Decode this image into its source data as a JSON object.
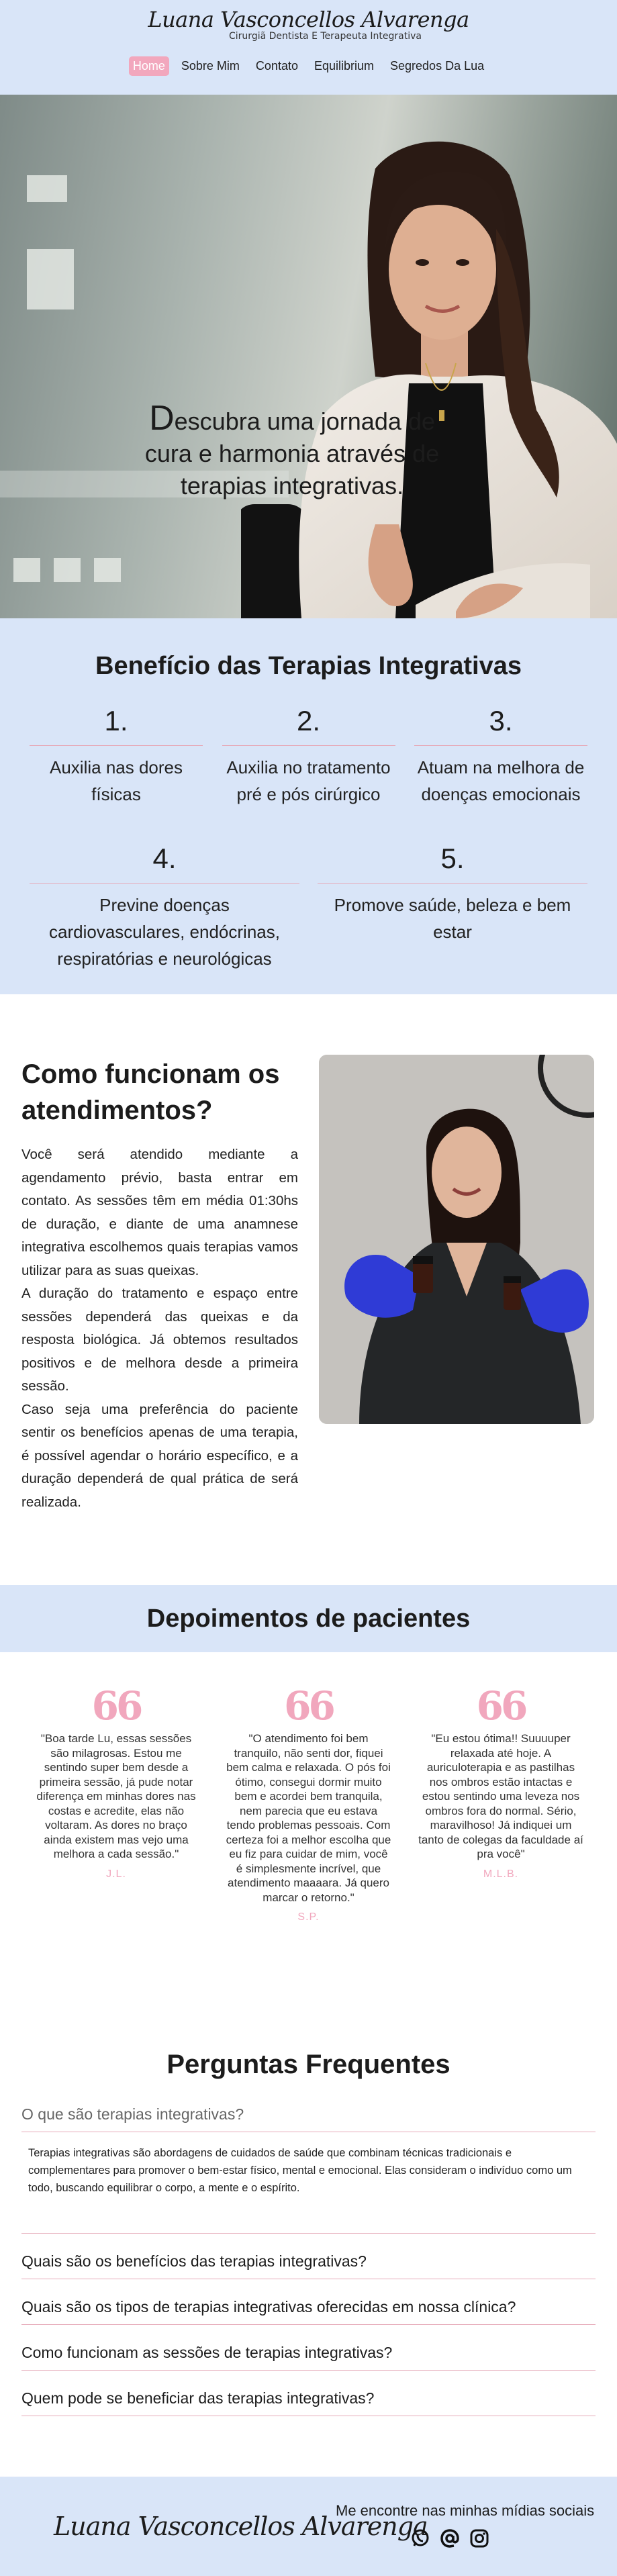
{
  "header": {
    "brand_name": "Luana Vasconcellos Alvarenga",
    "brand_subtitle": "Cirurgiã Dentista E Terapeuta Integrativa",
    "nav": [
      {
        "label": "Home",
        "active": true
      },
      {
        "label": "Sobre Mim",
        "active": false
      },
      {
        "label": "Contato",
        "active": false
      },
      {
        "label": "Equilibrium",
        "active": false
      },
      {
        "label": "Segredos Da Lua",
        "active": false
      }
    ]
  },
  "hero": {
    "first_letter": "D",
    "headline_rest": "escubra uma jornada de cura e harmonia através de terapias integrativas.",
    "scroll_icon": "arrow-down-icon"
  },
  "benefits": {
    "title": "Benefício das Terapias Integrativas",
    "items": [
      {
        "num": "1.",
        "text": "Auxilia nas dores físicas"
      },
      {
        "num": "2.",
        "text": "Auxilia no tratamento pré e pós cirúrgico"
      },
      {
        "num": "3.",
        "text": "Atuam na melhora de doenças emocionais"
      },
      {
        "num": "4.",
        "text": "Previne doenças cardiovasculares, endócrinas, respiratórias e neurológicas"
      },
      {
        "num": "5.",
        "text": "Promove saúde, beleza e bem estar"
      }
    ]
  },
  "how": {
    "title": "Como funcionam os atendimentos?",
    "paragraphs": [
      "Você será atendido mediante a agendamento prévio, basta entrar em contato. As sessões têm em média 01:30hs de duração, e diante de uma anamnese integrativa escolhemos quais terapias vamos utilizar para as suas queixas.",
      "A duração do tratamento e espaço entre sessões dependerá das queixas e da resposta biológica. Já obtemos resultados positivos e de melhora desde a primeira sessão.",
      "Caso seja uma preferência do paciente sentir os benefícios apenas de uma terapia, é possível agendar o horário específico, e a duração dependerá de qual prática de será realizada."
    ]
  },
  "testimonials": {
    "title": "Depoimentos de pacientes",
    "quote_mark": "66",
    "items": [
      {
        "text": "\"Boa tarde Lu, essas sessões são milagrosas. Estou me sentindo super bem desde a primeira sessão, já pude notar diferença em minhas dores nas costas e acredite, elas não voltaram. As dores no braço ainda existem mas vejo uma melhora a cada sessão.\"",
        "author": "J.L."
      },
      {
        "text": "\"O atendimento foi bem tranquilo, não senti dor, fiquei bem calma e relaxada. O pós foi ótimo, consegui dormir muito bem e acordei bem tranquila, nem parecia que eu estava tendo problemas pessoais. Com certeza foi a melhor escolha que eu fiz para cuidar de mim, você é simplesmente incrível, que atendimento maaaara. Já quero marcar o retorno.\"",
        "author": "S.P."
      },
      {
        "text": "\"Eu estou ótima!! Suuuuper relaxada até hoje. A auriculoterapia e as pastilhas nos ombros estão intactas e estou sentindo uma leveza nos ombros fora do normal. Sério, maravilhoso! Já indiquei um tanto de colegas da faculdade aí pra você\"",
        "author": "M.L.B."
      }
    ]
  },
  "faq": {
    "title": "Perguntas Frequentes",
    "items": [
      {
        "q": "O que são terapias integrativas?",
        "a": "Terapias integrativas são abordagens de cuidados de saúde que combinam técnicas tradicionais e complementares para promover o bem-estar físico, mental e emocional. Elas consideram o indivíduo como um todo, buscando equilibrar o corpo, a mente e o espírito.",
        "open": true
      },
      {
        "q": "Quais são os benefícios das terapias integrativas?",
        "open": false
      },
      {
        "q": "Quais são os tipos de terapias integrativas oferecidas em nossa clínica?",
        "open": false
      },
      {
        "q": "Como funcionam as sessões de terapias integrativas?",
        "open": false
      },
      {
        "q": "Quem pode se beneficiar das terapias integrativas?",
        "open": false
      }
    ]
  },
  "footer": {
    "brand": "Luana Vasconcellos Alvarenga",
    "social_label": "Me encontre nas minhas mídias sociais",
    "icons": [
      "whatsapp-icon",
      "email-at-icon",
      "instagram-icon"
    ]
  },
  "colors": {
    "accent_pink": "#f2a7bd",
    "section_blue": "#d9e5f8"
  }
}
